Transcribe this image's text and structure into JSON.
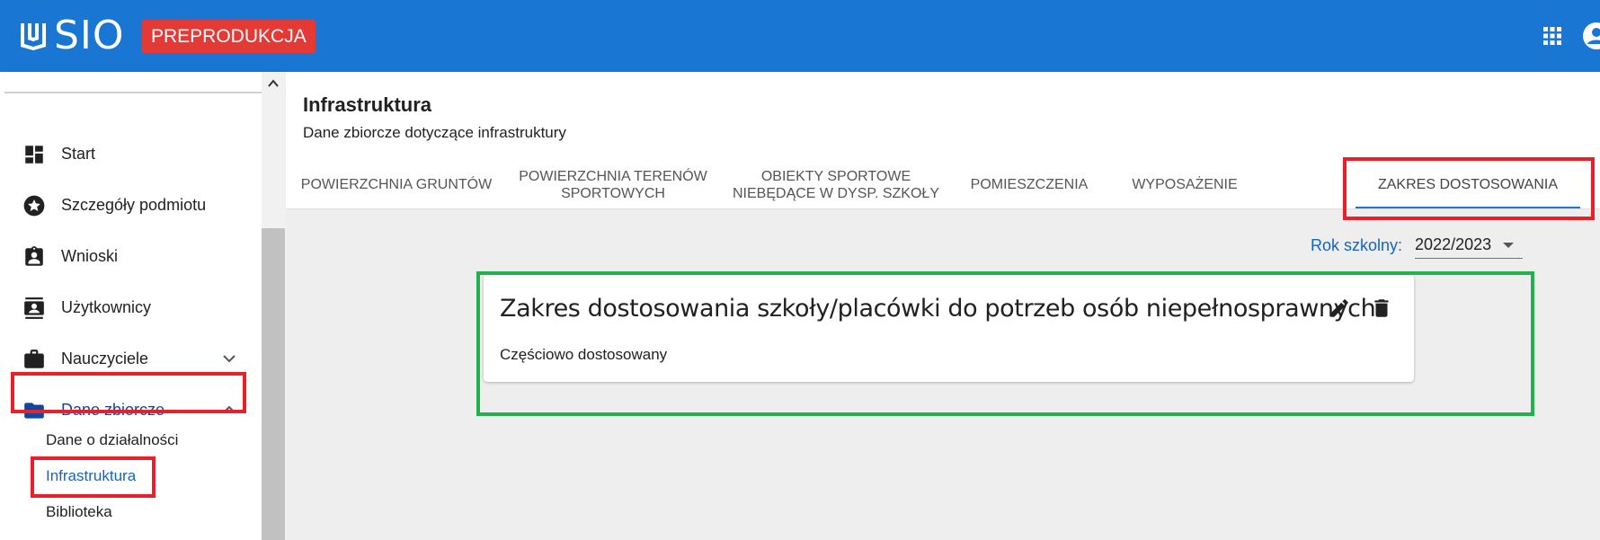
{
  "app": {
    "logo_text": "SIO",
    "environment_badge": "PREPRODUKCJA",
    "icons": {
      "logo": "book-logo-icon",
      "apps": "apps-grid-icon",
      "user": "account-circle-icon"
    }
  },
  "sidebar": {
    "items": [
      {
        "label": "Start",
        "icon": "dashboard-icon"
      },
      {
        "label": "Szczegóły podmiotu",
        "icon": "star-circle-icon"
      },
      {
        "label": "Wnioski",
        "icon": "clipboard-account-icon"
      },
      {
        "label": "Użytkownicy",
        "icon": "contact-card-icon"
      },
      {
        "label": "Nauczyciele",
        "icon": "briefcase-icon"
      },
      {
        "label": "Dane zbiorcze",
        "icon": "folder-icon"
      }
    ],
    "sub_items": [
      {
        "label": "Dane o działalności"
      },
      {
        "label": "Infrastruktura"
      },
      {
        "label": "Biblioteka"
      }
    ],
    "active_item": "Dane zbiorcze",
    "active_sub_item": "Infrastruktura"
  },
  "page": {
    "title": "Infrastruktura",
    "subtitle": "Dane zbiorcze dotyczące infrastruktury"
  },
  "tabs": [
    {
      "line1": "POWIERZCHNIA GRUNTÓW",
      "line2": ""
    },
    {
      "line1": "POWIERZCHNIA TERENÓW",
      "line2": "SPORTOWYCH"
    },
    {
      "line1": "OBIEKTY SPORTOWE",
      "line2": "NIEBĘDĄCE W DYSP. SZKOŁY"
    },
    {
      "line1": "POMIESZCZENIA",
      "line2": ""
    },
    {
      "line1": "WYPOSAŻENIE",
      "line2": ""
    },
    {
      "line1": "ZAKRES DOSTOSOWANIA",
      "line2": ""
    }
  ],
  "active_tab": "ZAKRES DOSTOSOWANIA",
  "school_year": {
    "label": "Rok szkolny:",
    "value": "2022/2023"
  },
  "card": {
    "title": "Zakres dostosowania szkoły/placówki do potrzeb osób niepełnosprawnych",
    "value": "Częściowo dostosowany",
    "actions": {
      "edit": "pencil-icon",
      "delete": "trash-icon"
    }
  },
  "colors": {
    "appbar": "#1976d2",
    "badge": "#e53935",
    "active_text": "#1565c0",
    "highlight_red": "#e8202a",
    "highlight_green": "#22b14c"
  }
}
